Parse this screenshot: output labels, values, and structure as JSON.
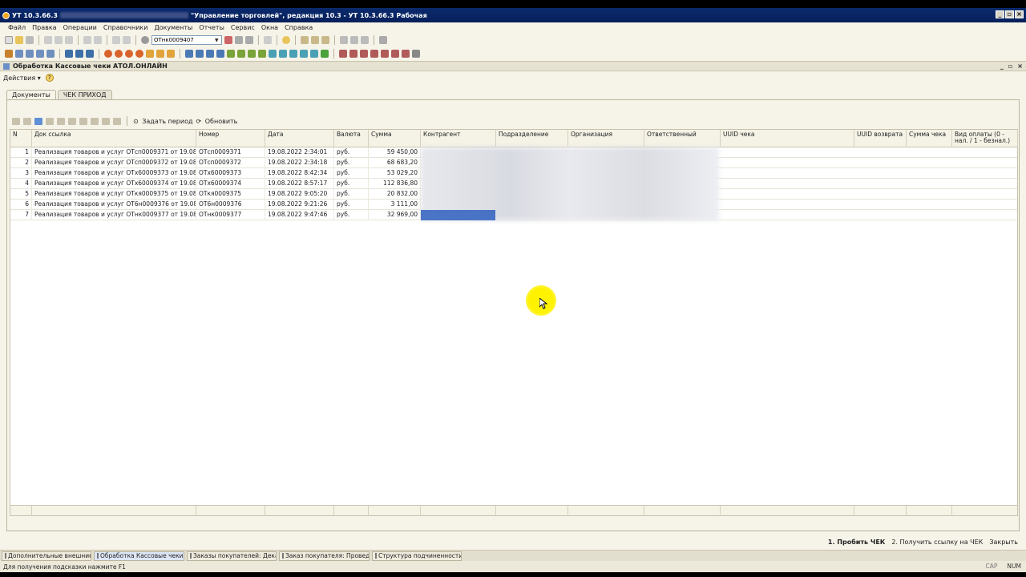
{
  "window": {
    "title_prefix": "УТ 10.3.66.3",
    "title_main": "\"Управление торговлей\", редакция 10.3 - УТ 10.3.66.3 Рабочая"
  },
  "menu": [
    "Файл",
    "Правка",
    "Операции",
    "Справочники",
    "Документы",
    "Отчеты",
    "Сервис",
    "Окна",
    "Справка"
  ],
  "toolbar": {
    "search_value": "ОТнк0009407"
  },
  "document": {
    "title": "Обработка  Кассовые чеки АТОЛ.ОНЛАЙН",
    "actions_label": "Действия",
    "tabs": [
      "Документы",
      "ЧЕК ПРИХОД"
    ],
    "set_period_label": "Задать период",
    "refresh_label": "Обновить"
  },
  "grid": {
    "columns": [
      "N",
      "Док ссылка",
      "Номер",
      "Дата",
      "Валюта",
      "Сумма",
      "Контрагент",
      "Подразделение",
      "Организация",
      "Ответственный",
      "UUID чека",
      "UUID возврата",
      "Сумма чека",
      "Вид оплаты (0 - нал. / 1 - безнал.)"
    ],
    "rows": [
      {
        "n": "1",
        "doc": "Реализация товаров и услуг ОТсп0009371 от 19.08.2022 ...",
        "num": "ОТсп0009371",
        "date": "19.08.2022 2:34:01",
        "cur": "руб.",
        "sum": "59 450,00"
      },
      {
        "n": "2",
        "doc": "Реализация товаров и услуг ОТсп0009372 от 19.08.2022 ...",
        "num": "ОТсп0009372",
        "date": "19.08.2022 2:34:18",
        "cur": "руб.",
        "sum": "68 683,20"
      },
      {
        "n": "3",
        "doc": "Реализация товаров и услуг ОТх60009373 от 19.08.2022 ...",
        "num": "ОТх60009373",
        "date": "19.08.2022 8:42:34",
        "cur": "руб.",
        "sum": "53 029,20"
      },
      {
        "n": "4",
        "doc": "Реализация товаров и услуг ОТх60009374 от 19.08.2022 ...",
        "num": "ОТх60009374",
        "date": "19.08.2022 8:57:17",
        "cur": "руб.",
        "sum": "112 836,80"
      },
      {
        "n": "5",
        "doc": "Реализация товаров и услуг ОТкя0009375 от 19.08.2022 ...",
        "num": "ОТкя0009375",
        "date": "19.08.2022 9:05:20",
        "cur": "руб.",
        "sum": "20 832,00"
      },
      {
        "n": "6",
        "doc": "Реализация товаров и услуг ОТ6н0009376 от 19.08.2022 ...",
        "num": "ОТ6н0009376",
        "date": "19.08.2022 9:21:26",
        "cur": "руб.",
        "sum": "3 111,00"
      },
      {
        "n": "7",
        "doc": "Реализация товаров и услуг ОТнк0009377 от 19.08.2022 ...",
        "num": "ОТнк0009377",
        "date": "19.08.2022 9:47:46",
        "cur": "руб.",
        "sum": "32 969,00"
      }
    ]
  },
  "commands": {
    "punch": "1. Пробить ЧЕК",
    "get_link": "2. Получить ссылку на ЧЕК",
    "close": "Закрыть"
  },
  "taskbar": [
    "Дополнительные внешние о...",
    "Обработка  Кассовые чеки ...",
    "Заказы покупателей: Дека...",
    "Заказ покупателя: Проведен",
    "Структура подчиненности д..."
  ],
  "status": {
    "hint": "Для получения подсказки нажмите F1",
    "cap": "CAP",
    "num": "NUM"
  }
}
